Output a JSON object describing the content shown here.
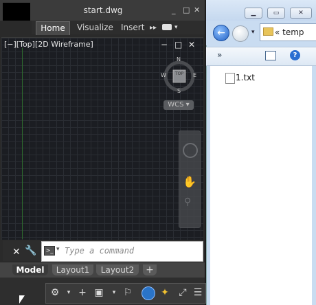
{
  "cad": {
    "title": "start.dwg",
    "window_controls": [
      "_",
      "□",
      "✕"
    ],
    "ribbon_tabs": [
      "Home",
      "Visualize",
      "Insert"
    ],
    "ribbon_more": "▸▸",
    "viewport_label": "[−][Top][2D Wireframe]",
    "viewport_controls": [
      "−",
      "□",
      "✕"
    ],
    "viewcube": {
      "face": "TOP",
      "n": "N",
      "s": "S",
      "e": "E",
      "w": "W"
    },
    "wcs_label": "WCS",
    "command_placeholder": "Type a command",
    "layout_tabs": [
      "Model",
      "Layout1",
      "Layout2",
      "+"
    ]
  },
  "explorer": {
    "address_text": "« temp",
    "files": [
      {
        "name": "1.txt"
      }
    ]
  }
}
